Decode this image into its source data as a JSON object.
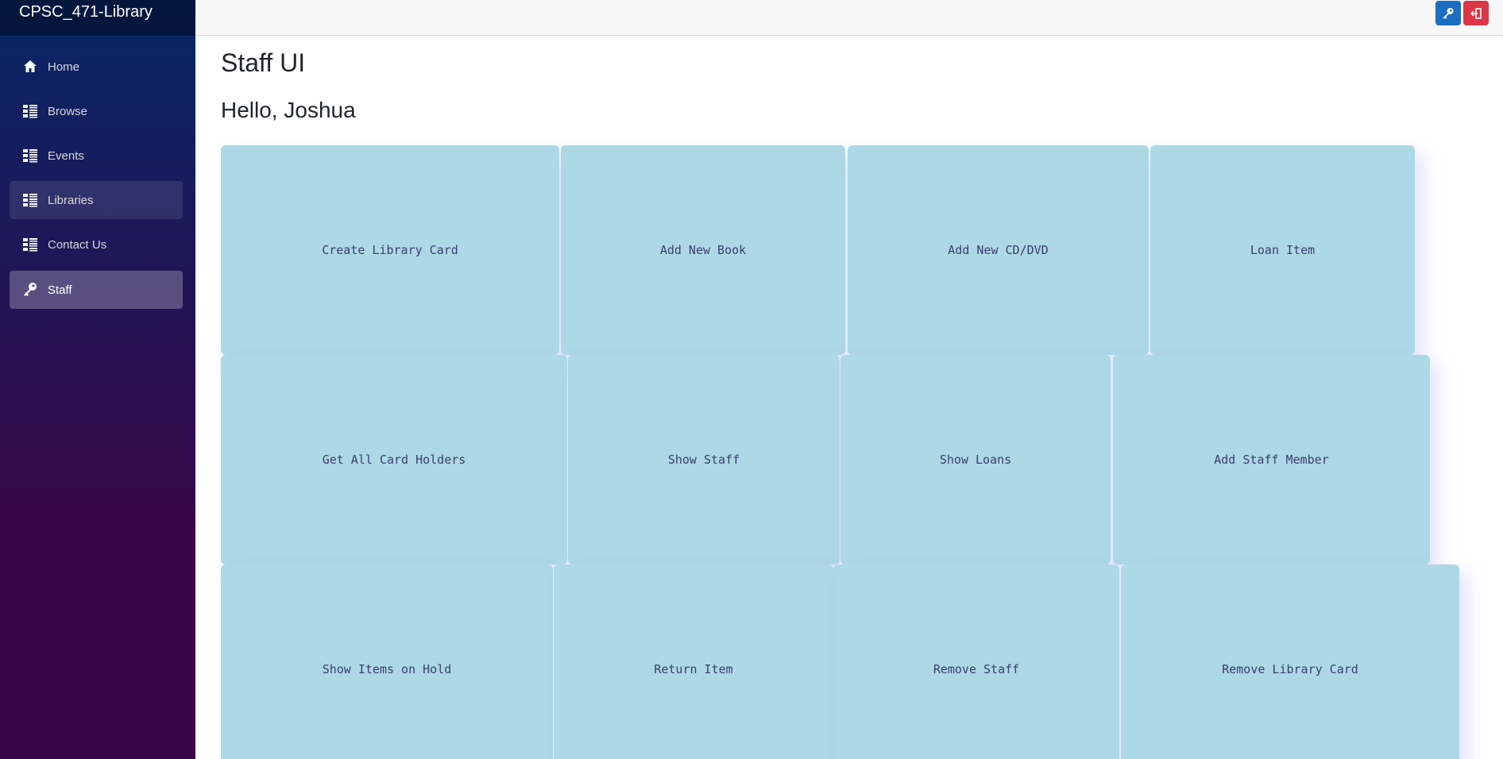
{
  "app": {
    "brand": "CPSC_471-Library"
  },
  "sidebar": {
    "items": [
      {
        "label": "Home",
        "icon": "home-icon"
      },
      {
        "label": "Browse",
        "icon": "list-icon"
      },
      {
        "label": "Events",
        "icon": "list-icon"
      },
      {
        "label": "Libraries",
        "icon": "list-icon"
      },
      {
        "label": "Contact Us",
        "icon": "list-icon"
      },
      {
        "label": "Staff",
        "icon": "key-icon"
      }
    ],
    "active": "Staff",
    "hovered": "Libraries"
  },
  "topbar": {
    "buttons": [
      {
        "icon": "key-icon",
        "color": "#1b6ec2"
      },
      {
        "icon": "logout-icon",
        "color": "#dc3545"
      }
    ]
  },
  "main": {
    "title": "Staff UI",
    "greeting": "Hello, Joshua",
    "actions": [
      [
        "Create Library Card",
        "Add New Book",
        "Add New CD/DVD",
        "Loan Item"
      ],
      [
        "Get All Card Holders",
        "Show Staff",
        "Show Loans",
        "Add Staff Member"
      ],
      [
        "Show Items on Hold",
        "Return Item",
        "Remove Staff",
        "Remove Library Card"
      ]
    ]
  },
  "colors": {
    "card_background": "#add8e6",
    "card_text": "#3a3f6e",
    "sidebar_top": "#052767",
    "sidebar_bottom": "#3a0647"
  }
}
